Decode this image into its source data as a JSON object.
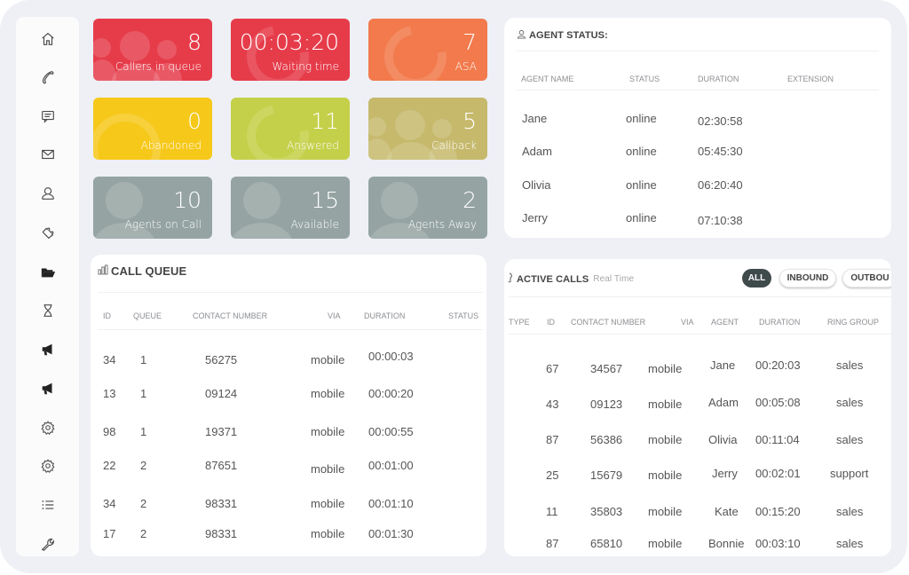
{
  "sidebar": {
    "items": [
      {
        "icon": "home-icon",
        "label": "Home"
      },
      {
        "icon": "phone-icon",
        "label": "Calls"
      },
      {
        "icon": "message-icon",
        "label": "Messages"
      },
      {
        "icon": "mail-icon",
        "label": "Mail"
      },
      {
        "icon": "user-icon",
        "label": "Users"
      },
      {
        "icon": "puzzle-icon",
        "label": "Integrations"
      },
      {
        "icon": "folder-icon",
        "label": "Files"
      },
      {
        "icon": "hourglass-icon",
        "label": "History"
      },
      {
        "icon": "megaphone-icon",
        "label": "Campaigns"
      },
      {
        "icon": "megaphone-icon",
        "label": "Broadcasts"
      },
      {
        "icon": "gear-icon",
        "label": "Settings"
      },
      {
        "icon": "gear-icon",
        "label": "Advanced Settings"
      },
      {
        "icon": "list-icon",
        "label": "Lists"
      },
      {
        "icon": "wrench-icon",
        "label": "Tools"
      }
    ]
  },
  "tiles": [
    {
      "value": "8",
      "label": "Callers in queue",
      "color": "#e63c4a",
      "deco": "group"
    },
    {
      "value": "00:03:20",
      "label": "Waiting time",
      "color": "#e63c4a",
      "deco": "phone"
    },
    {
      "value": "7",
      "label": "ASA",
      "color": "#f27a4c",
      "deco": "phone"
    },
    {
      "value": "0",
      "label": "Abandoned",
      "color": "#f6c81a",
      "deco": "ring"
    },
    {
      "value": "11",
      "label": "Answered",
      "color": "#c5d04a",
      "deco": "phone"
    },
    {
      "value": "5",
      "label": "Callback",
      "color": "#c6b96c",
      "deco": "group"
    },
    {
      "value": "10",
      "label": "Agents on Call",
      "color": "#95a4a2",
      "deco": "person"
    },
    {
      "value": "15",
      "label": "Available",
      "color": "#95a4a2",
      "deco": "person"
    },
    {
      "value": "2",
      "label": "Agents Away",
      "color": "#95a4a2",
      "deco": "person"
    }
  ],
  "agent_status": {
    "title": "AGENT STATUS:",
    "columns": [
      "AGENT NAME",
      "STATUS",
      "DURATION",
      "EXTENSION"
    ],
    "rows": [
      {
        "name": "Jane",
        "status": "online",
        "duration": "02:30:58",
        "extension": ""
      },
      {
        "name": "Adam",
        "status": "online",
        "duration": "05:45:30",
        "extension": ""
      },
      {
        "name": "Olivia",
        "status": "online",
        "duration": "06:20:40",
        "extension": ""
      },
      {
        "name": "Jerry",
        "status": "online",
        "duration": "07:10:38",
        "extension": ""
      }
    ]
  },
  "call_queue": {
    "title": "CALL QUEUE",
    "columns": [
      "ID",
      "QUEUE",
      "CONTACT NUMBER",
      "VIA",
      "DURATION",
      "STATUS"
    ],
    "rows": [
      {
        "id": "34",
        "queue": "1",
        "contact": "56275",
        "via": "mobile",
        "duration": "00:00:03",
        "status": ""
      },
      {
        "id": "13",
        "queue": "1",
        "contact": "09124",
        "via": "mobile",
        "duration": "00:00:20",
        "status": ""
      },
      {
        "id": "98",
        "queue": "1",
        "contact": "19371",
        "via": "mobile",
        "duration": "00:00:55",
        "status": ""
      },
      {
        "id": "22",
        "queue": "2",
        "contact": "87651",
        "via": "mobile",
        "duration": "00:01:00",
        "status": ""
      },
      {
        "id": "34",
        "queue": "2",
        "contact": "98331",
        "via": "mobile",
        "duration": "00:01:10",
        "status": ""
      },
      {
        "id": "17",
        "queue": "2",
        "contact": "98331",
        "via": "mobile",
        "duration": "00:01:30",
        "status": ""
      }
    ]
  },
  "active_calls": {
    "title": "ACTIVE CALLS",
    "subtitle": "Real Time",
    "filters": [
      {
        "label": "ALL",
        "active": true
      },
      {
        "label": "INBOUND",
        "active": false
      },
      {
        "label": "OUTBOU",
        "active": false
      }
    ],
    "columns": [
      "TYPE",
      "ID",
      "CONTACT NUMBER",
      "VIA",
      "AGENT",
      "DURATION",
      "RING GROUP"
    ],
    "rows": [
      {
        "type": "",
        "id": "67",
        "contact": "34567",
        "via": "mobile",
        "agent": "Jane",
        "duration": "00:20:03",
        "ring_group": "sales"
      },
      {
        "type": "",
        "id": "43",
        "contact": "09123",
        "via": "mobile",
        "agent": "Adam",
        "duration": "00:05:08",
        "ring_group": "sales"
      },
      {
        "type": "",
        "id": "87",
        "contact": "56386",
        "via": "mobile",
        "agent": "Olivia",
        "duration": "00:11:04",
        "ring_group": "sales"
      },
      {
        "type": "",
        "id": "25",
        "contact": "15679",
        "via": "mobile",
        "agent": "Jerry",
        "duration": "00:02:01",
        "ring_group": "support"
      },
      {
        "type": "",
        "id": "11",
        "contact": "35803",
        "via": "mobile",
        "agent": "Kate",
        "duration": "00:15:20",
        "ring_group": "sales"
      },
      {
        "type": "",
        "id": "87",
        "contact": "65810",
        "via": "mobile",
        "agent": "Bonnie",
        "duration": "00:03:10",
        "ring_group": "sales"
      }
    ]
  }
}
